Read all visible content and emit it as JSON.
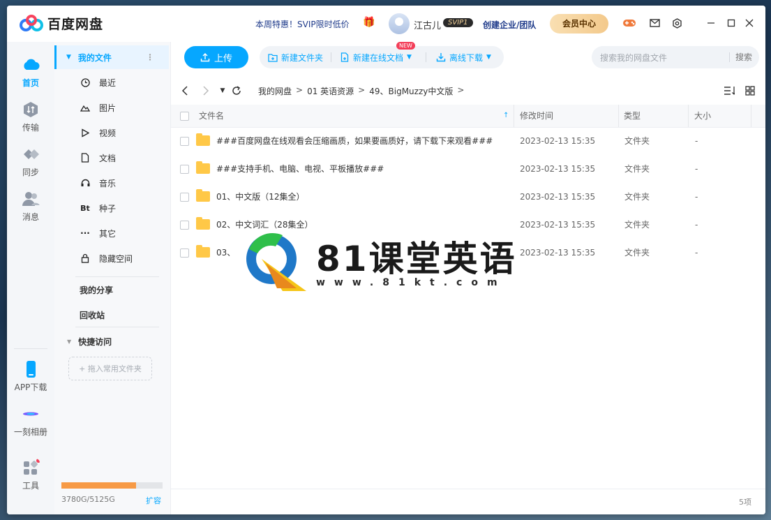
{
  "app": {
    "title": "百度网盘"
  },
  "header": {
    "promo": "本周特惠！SVIP限时低价",
    "username": "江古儿",
    "badge": "SVIP1",
    "enterprise": "创建企业/团队",
    "vip_center": "会员中心"
  },
  "nav": [
    {
      "label": "首页"
    },
    {
      "label": "传输"
    },
    {
      "label": "同步"
    },
    {
      "label": "消息"
    },
    {
      "label": "APP下载"
    },
    {
      "label": "一刻相册"
    },
    {
      "label": "工具"
    }
  ],
  "sidebar": {
    "my_files": "我的文件",
    "items": [
      {
        "label": "最近",
        "icon": "clock-icon"
      },
      {
        "label": "图片",
        "icon": "image-icon"
      },
      {
        "label": "视频",
        "icon": "play-icon"
      },
      {
        "label": "文档",
        "icon": "document-icon"
      },
      {
        "label": "音乐",
        "icon": "headphones-icon"
      },
      {
        "label": "种子",
        "icon": "bt-icon",
        "glyph": "Bt"
      },
      {
        "label": "其它",
        "icon": "more-icon"
      },
      {
        "label": "隐藏空间",
        "icon": "lock-icon"
      }
    ],
    "my_share": "我的分享",
    "recycle": "回收站",
    "quick_access": "快捷访问",
    "quick_drop": "+ 拖入常用文件夹",
    "storage": {
      "text": "3780G/5125G",
      "used_fraction": 0.74,
      "expand": "扩容"
    }
  },
  "toolbar": {
    "upload": "上传",
    "new_folder": "新建文件夹",
    "new_online_doc": "新建在线文档",
    "new_badge": "NEW",
    "offline_download": "离线下载",
    "search_placeholder": "搜索我的网盘文件",
    "search_button": "搜索"
  },
  "breadcrumb": [
    "我的网盘",
    "01 英语资源",
    "49、BigMuzzy中文版"
  ],
  "columns": {
    "name": "文件名",
    "modified": "修改时间",
    "type": "类型",
    "size": "大小"
  },
  "files": [
    {
      "name": "###百度网盘在线观看会压缩画质，如果要画质好，请下载下来观看###",
      "modified": "2023-02-13 15:35",
      "type": "文件夹",
      "size": "-"
    },
    {
      "name": "###支持手机、电脑、电视、平板播放###",
      "modified": "2023-02-13 15:35",
      "type": "文件夹",
      "size": "-"
    },
    {
      "name": "01、中文版（12集全）",
      "modified": "2023-02-13 15:35",
      "type": "文件夹",
      "size": "-"
    },
    {
      "name": "02、中文词汇（28集全）",
      "modified": "2023-02-13 15:35",
      "type": "文件夹",
      "size": "-"
    },
    {
      "name": "03、",
      "modified": "2023-02-13 15:35",
      "type": "文件夹",
      "size": "-"
    }
  ],
  "footer": {
    "count": "5项"
  },
  "watermark": {
    "title": "81课堂英语",
    "url": "www.81kt.com"
  },
  "colors": {
    "accent": "#06a7ff",
    "folder": "#ffc847",
    "storage_fill": "#f79a45",
    "promo": "#1e3a8a"
  }
}
